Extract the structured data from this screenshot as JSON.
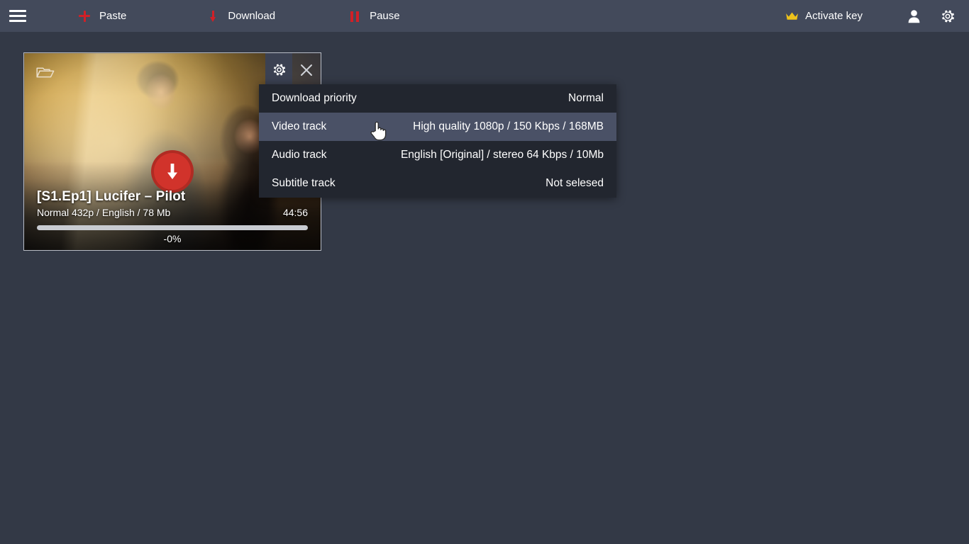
{
  "toolbar": {
    "menu_icon": "hamburger-icon",
    "buttons": [
      {
        "label": "Paste",
        "icon": "plus-icon"
      },
      {
        "label": "Download",
        "icon": "download-arrow-icon"
      },
      {
        "label": "Pause",
        "icon": "pause-icon"
      }
    ],
    "activate_key_label": "Activate key",
    "crown_icon": "crown-icon",
    "account_icon": "user-icon",
    "settings_icon": "gear-icon",
    "bg_color": "#434a5b"
  },
  "page": {
    "bg_color": "#333946"
  },
  "card": {
    "folder_icon": "open-folder-icon",
    "gear_icon": "gear-icon",
    "close_icon": "close-icon",
    "download_icon": "download-arrow-icon",
    "title": "[S1.Ep1] Lucifer – Pilot",
    "meta": "Normal 432p / English / 78 Mb",
    "duration": "44:56",
    "progress_label": "-0%",
    "progress_percent": 0,
    "accent_color": "#d1332b"
  },
  "context_menu": {
    "rows": [
      {
        "label": "Download priority",
        "value": "Normal",
        "hovered": false
      },
      {
        "label": "Video track",
        "value": "High quality 1080p / 150 Kbps / 168MB",
        "hovered": true
      },
      {
        "label": "Audio track",
        "value": "English [Original] / stereo 64 Kbps / 10Mb",
        "hovered": false
      },
      {
        "label": "Subtitle track",
        "value": "Not selesed",
        "hovered": false
      }
    ],
    "bg_color": "#22262f",
    "hover_color": "#4a5166"
  },
  "cursor": {
    "type": "pointing-hand-cursor"
  }
}
